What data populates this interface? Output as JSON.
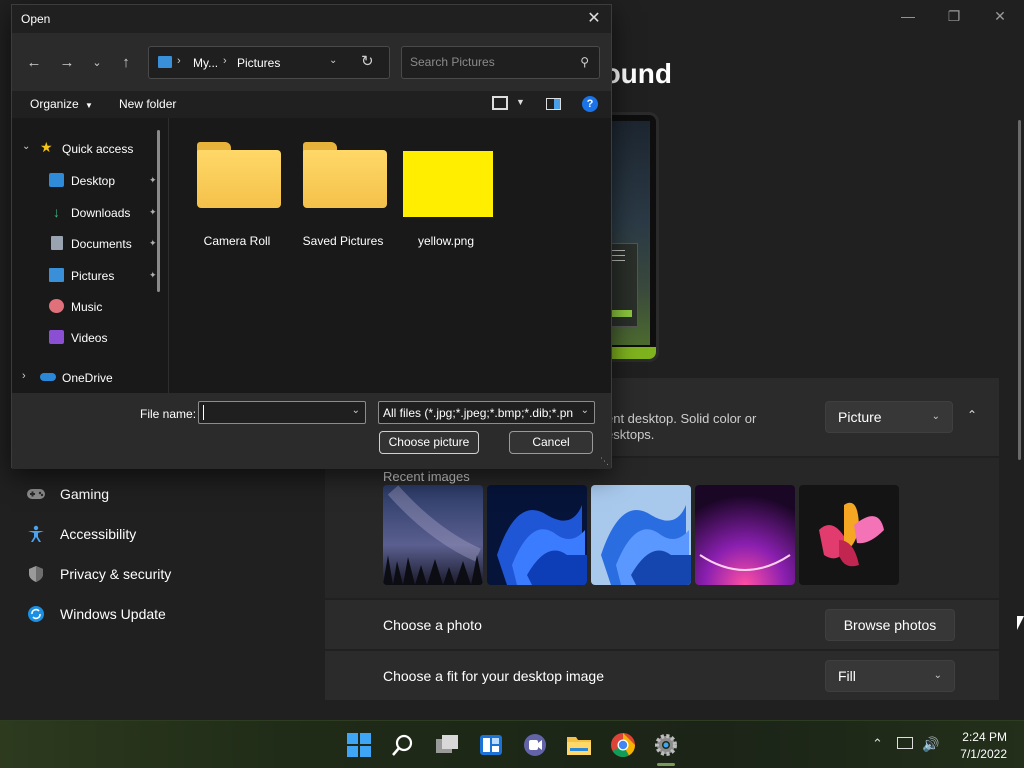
{
  "settings": {
    "heading": "kground",
    "personalize": {
      "description_line1": "ent desktop. Solid color or",
      "description_line2": "esktops.",
      "dropdown_value": "Picture"
    },
    "recent_images_label": "Recent images",
    "choose_photo_label": "Choose a photo",
    "browse_button": "Browse photos",
    "fit_label": "Choose a fit for your desktop image",
    "fit_value": "Fill",
    "nav_items": [
      {
        "label": "Gaming",
        "icon": "gaming-icon"
      },
      {
        "label": "Accessibility",
        "icon": "accessibility-icon"
      },
      {
        "label": "Privacy & security",
        "icon": "shield-icon"
      },
      {
        "label": "Windows Update",
        "icon": "windows-update-icon"
      }
    ]
  },
  "dialog": {
    "title": "Open",
    "breadcrumb": [
      "My...",
      "Pictures"
    ],
    "search_placeholder": "Search Pictures",
    "organize_label": "Organize",
    "new_folder_label": "New folder",
    "tree": {
      "quick_access": "Quick access",
      "items": [
        {
          "label": "Desktop",
          "pinned": true
        },
        {
          "label": "Downloads",
          "pinned": true
        },
        {
          "label": "Documents",
          "pinned": true
        },
        {
          "label": "Pictures",
          "pinned": true
        },
        {
          "label": "Music",
          "pinned": false
        },
        {
          "label": "Videos",
          "pinned": false
        }
      ],
      "onedrive": "OneDrive"
    },
    "files": [
      {
        "name": "Camera Roll",
        "type": "folder"
      },
      {
        "name": "Saved Pictures",
        "type": "folder"
      },
      {
        "name": "yellow.png",
        "type": "image",
        "color": "#ffee00"
      }
    ],
    "filename_label": "File name:",
    "filename_value": "",
    "filetype_value": "All files (*.jpg;*.jpeg;*.bmp;*.dib;*.png",
    "choose_button": "Choose picture",
    "cancel_button": "Cancel"
  },
  "taskbar": {
    "time": "2:24 PM",
    "date": "7/1/2022"
  },
  "colors": {
    "accent": "#1a73e8",
    "folder": "#f4c14a",
    "yellow_image": "#ffee00"
  }
}
